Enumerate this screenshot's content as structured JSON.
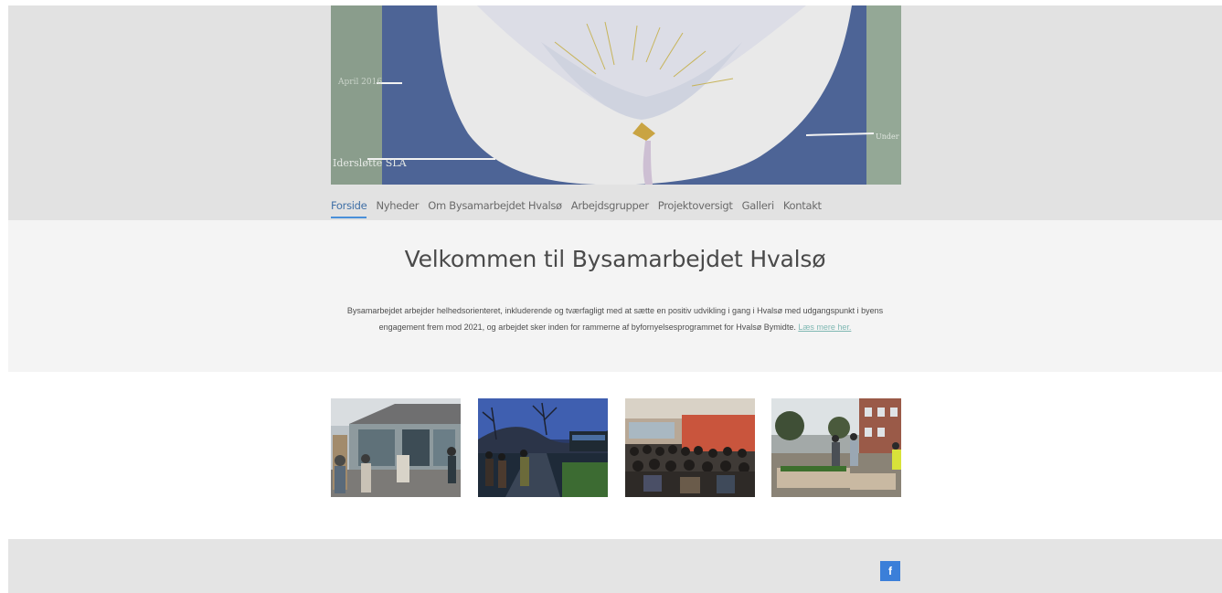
{
  "nav": {
    "items": [
      {
        "label": "Forside",
        "active": true
      },
      {
        "label": "Nyheder"
      },
      {
        "label": "Om Bysamarbejdet Hvalsø"
      },
      {
        "label": "Arbejdsgrupper"
      },
      {
        "label": "Projektoversigt"
      },
      {
        "label": "Galleri"
      },
      {
        "label": "Kontakt"
      }
    ]
  },
  "hero": {
    "painted_text": {
      "left_date": "April 2016",
      "left_caption": "Idersløtte SLA",
      "right_caption": "Under"
    }
  },
  "welcome": {
    "title": "Velkommen til Bysamarbejdet Hvalsø",
    "body": "Bysamarbejdet arbejder helhedsorienteret, inkluderende og tværfagligt med at sætte en positiv udvikling i gang i Hvalsø med udgangspunkt i byens engagement frem mod 2021, og arbejdet sker inden for rammerne af byfornyelsesprogrammet for Hvalsø Bymidte.",
    "link_label": "Læs mere her."
  },
  "gallery": {
    "images": [
      "shop-front-photo",
      "evening-walk-photo",
      "meeting-audience-photo",
      "raised-garden-beds-photo"
    ]
  },
  "footer": {
    "facebook_label": "f",
    "colors": {
      "facebook": "#3b7fd9"
    }
  },
  "colors": {
    "accent": "#4a90d9",
    "link": "#7fb8b3",
    "band": "#e2e2e2",
    "welcome_bg": "#f4f4f4"
  }
}
